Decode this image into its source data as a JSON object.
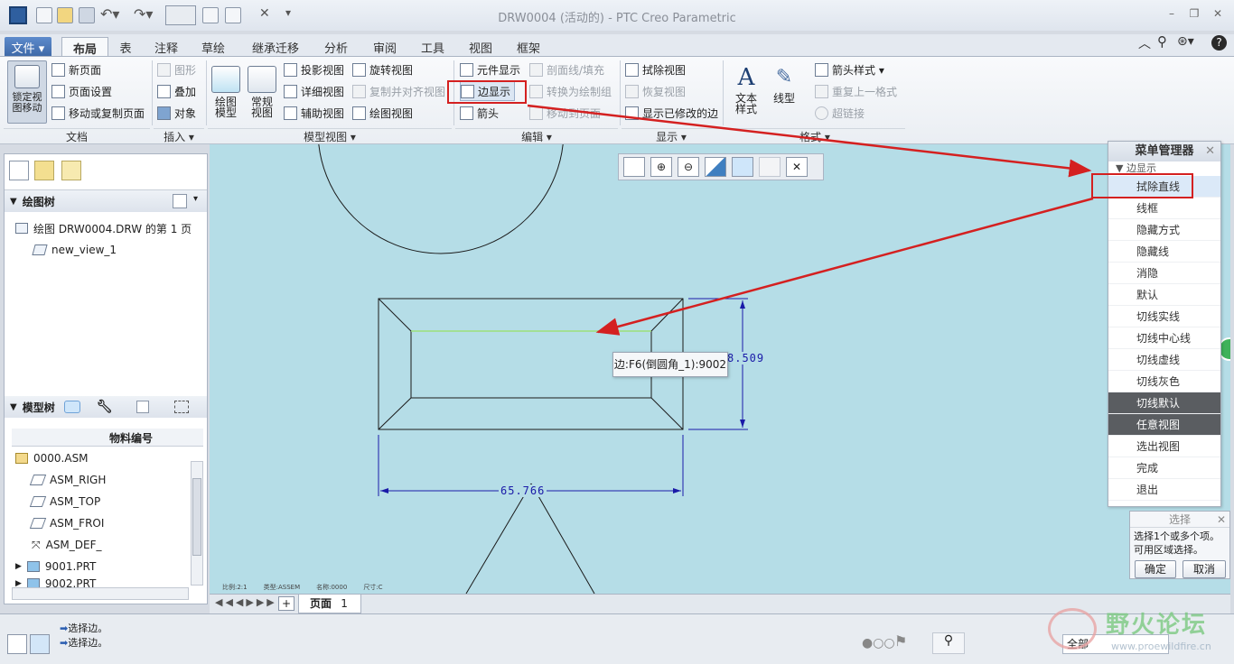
{
  "window": {
    "title": "DRW0004 (活动的) - PTC Creo Parametric"
  },
  "menu_tabs": [
    "文件 ▾",
    "布局",
    "表",
    "注释",
    "草绘",
    "继承迁移",
    "分析",
    "审阅",
    "工具",
    "视图",
    "框架"
  ],
  "ribbon": {
    "doc_group": {
      "lock_label": "锁定视\n图移动",
      "items": [
        "新页面",
        "页面设置",
        "移动或复制页面"
      ],
      "label": "文档"
    },
    "insert_group": {
      "items": [
        "图形",
        "叠加",
        "对象"
      ],
      "label": "插入 ▾"
    },
    "model_group": {
      "big1": "绘图\n模型",
      "big2": "常规\n视图",
      "col1": [
        "投影视图",
        "详细视图",
        "辅助视图"
      ],
      "col2": [
        "旋转视图",
        "复制并对齐视图",
        "绘图视图"
      ],
      "label": "模型视图 ▾"
    },
    "edit_group": {
      "col1": [
        "元件显示",
        "边显示",
        "箭头"
      ],
      "col2": [
        "剖面线/填充",
        "转换为绘制组",
        "移动到页面"
      ],
      "label": "编辑 ▾"
    },
    "display_group": {
      "items": [
        "拭除视图",
        "恢复视图",
        "显示已修改的边"
      ],
      "label": "显示 ▾"
    },
    "format_group": {
      "big1": "文本\n样式",
      "big2": "线型",
      "items": [
        "箭头样式 ▾",
        "重复上一格式",
        "超链接"
      ],
      "label": "格式 ▾"
    }
  },
  "left_panel": {
    "drawing_tree_title": "绘图树",
    "drawing_tree_items": [
      "绘图 DRW0004.DRW 的第 1 页",
      "new_view_1"
    ],
    "model_tree_title": "模型树",
    "model_tree_column": "物料编号",
    "model_tree_items": [
      "0000.ASM",
      "ASM_RIGH",
      "ASM_TOP",
      "ASM_FROI",
      "ASM_DEF_",
      "9001.PRT",
      "9002.PRT"
    ]
  },
  "canvas": {
    "dim_vertical": "8.509",
    "dim_horizontal": "65.766",
    "tooltip": "边:F6(倒圆角_1):9002",
    "footer_text": [
      "比例:2:1",
      "类型:ASSEM",
      "名称:0000",
      "尺寸:C"
    ]
  },
  "page_bar": {
    "page_label": "页面",
    "page_number": "1"
  },
  "menu_manager": {
    "title": "菜单管理器",
    "section": "边显示",
    "items": [
      "拭除直线",
      "线框",
      "隐藏方式",
      "隐藏线",
      "消隐",
      "默认",
      "切线实线",
      "切线中心线",
      "切线虚线",
      "切线灰色",
      "切线默认",
      "任意视图",
      "选出视图",
      "完成",
      "退出"
    ]
  },
  "selection_box": {
    "title": "选择",
    "line1": "选择1个或多个项。",
    "line2": "可用区域选择。",
    "ok": "确定",
    "cancel": "取消"
  },
  "status": {
    "messages": [
      "选择边。",
      "选择边。"
    ],
    "filter": "全部"
  },
  "watermark": {
    "text": "野火论坛",
    "url": "www.proewildfire.cn"
  },
  "colors": {
    "canvas_bg": "#b5dde7",
    "highlight_red": "#d42020",
    "drawing_blue": "#1a1aa8"
  }
}
